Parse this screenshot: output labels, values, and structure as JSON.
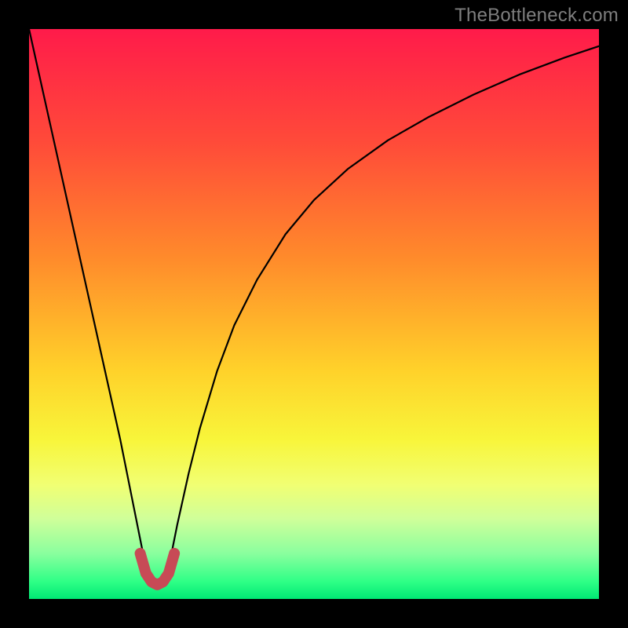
{
  "watermark": "TheBottleneck.com",
  "chart_data": {
    "type": "line",
    "title": "",
    "xlabel": "",
    "ylabel": "",
    "xlim": [
      0,
      100
    ],
    "ylim": [
      0,
      100
    ],
    "gradient_stops": [
      {
        "offset": 0,
        "color": "#ff1b4a"
      },
      {
        "offset": 20,
        "color": "#ff4b39"
      },
      {
        "offset": 40,
        "color": "#ff8a2b"
      },
      {
        "offset": 60,
        "color": "#ffd22a"
      },
      {
        "offset": 72,
        "color": "#f8f53a"
      },
      {
        "offset": 80,
        "color": "#f1ff73"
      },
      {
        "offset": 86,
        "color": "#cfff9a"
      },
      {
        "offset": 92,
        "color": "#8aff9e"
      },
      {
        "offset": 97,
        "color": "#2eff86"
      },
      {
        "offset": 100,
        "color": "#00e874"
      }
    ],
    "series": [
      {
        "name": "bottleneck-curve",
        "color": "#000000",
        "x": [
          0,
          2,
          4,
          6,
          8,
          10,
          12,
          14,
          16,
          18,
          19,
          20,
          21,
          22,
          23,
          24,
          25,
          26,
          28,
          30,
          33,
          36,
          40,
          45,
          50,
          56,
          63,
          70,
          78,
          86,
          94,
          100
        ],
        "y": [
          100,
          91,
          82,
          73,
          64,
          55,
          46,
          37,
          28,
          18,
          13,
          8,
          4.5,
          3,
          3,
          4.5,
          8,
          13,
          22,
          30,
          40,
          48,
          56,
          64,
          70,
          75.5,
          80.5,
          84.5,
          88.5,
          92,
          95,
          97
        ]
      },
      {
        "name": "valley-marker",
        "color": "#c74a56",
        "x": [
          19.5,
          20.5,
          21.5,
          22.5,
          23.5,
          24.5,
          25.5
        ],
        "y": [
          8,
          4.5,
          3,
          2.5,
          3,
          4.5,
          8
        ]
      }
    ],
    "annotations": []
  }
}
